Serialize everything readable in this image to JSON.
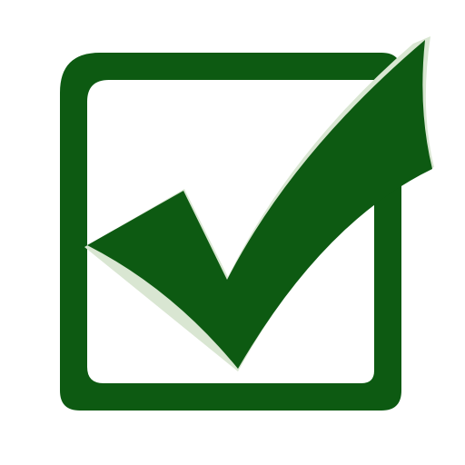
{
  "icon": {
    "name": "checked-checkbox-icon",
    "checked": true
  },
  "colors": {
    "background": "#ffffff",
    "box_stroke": "#0d5a12",
    "check_fill": "#0d5a12",
    "check_highlight": "#d9e6d2"
  }
}
